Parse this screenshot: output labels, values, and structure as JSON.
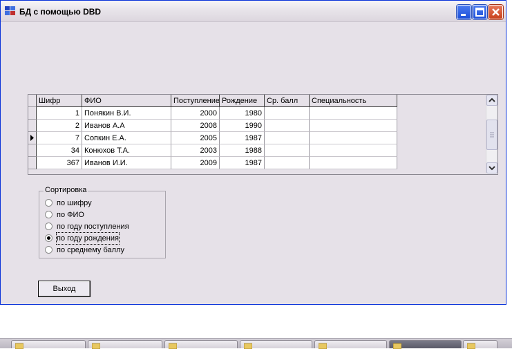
{
  "window": {
    "title": "БД с помощью DBD"
  },
  "grid": {
    "columns": [
      "Шифр",
      "ФИО",
      "Поступление",
      "Рождение",
      "Ср. балл",
      "Специальность"
    ],
    "rows": [
      [
        "1",
        "Понякин В.И.",
        "2000",
        "1980",
        "",
        ""
      ],
      [
        "2",
        "Иванов А.А",
        "2008",
        "1990",
        "",
        ""
      ],
      [
        "7",
        "Сопкин Е.А.",
        "2005",
        "1987",
        "",
        ""
      ],
      [
        "34",
        "Конюхов Т.А.",
        "2003",
        "1988",
        "",
        ""
      ],
      [
        "367",
        "Иванов И.И.",
        "2009",
        "1987",
        "",
        ""
      ]
    ],
    "current_row": 2
  },
  "sort": {
    "title": "Сортировка",
    "options": [
      "по шифру",
      "по ФИО",
      "по году поступления",
      "по году рождения",
      "по среднему баллу"
    ],
    "selected": 3
  },
  "exit_label": "Выход",
  "colors": {
    "title_border": "#0831d9",
    "window_bg": "#e6e1e8",
    "minmax_btn": "#2c5ce0",
    "close_btn": "#d0502a"
  },
  "taskbar": {
    "items": 7,
    "active_index": 5
  }
}
